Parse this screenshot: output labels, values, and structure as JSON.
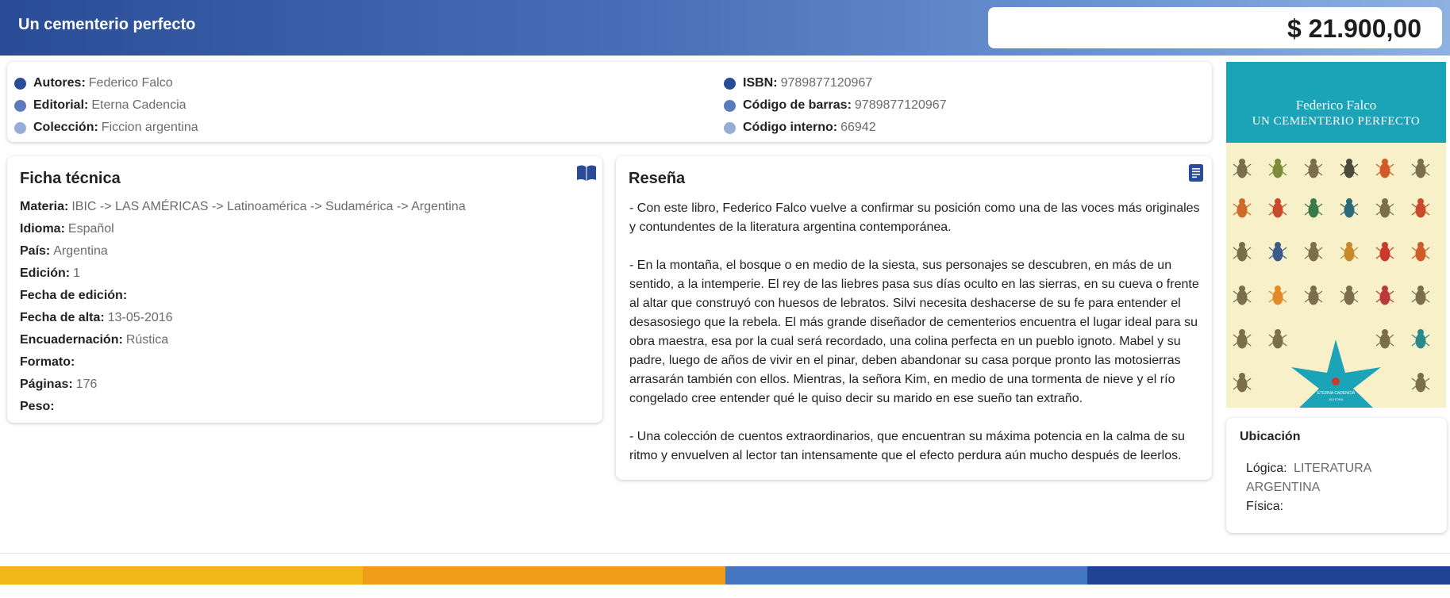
{
  "header": {
    "title": "Un cementerio perfecto",
    "price": "$ 21.900,00"
  },
  "info": {
    "left": [
      {
        "label": "Autores:",
        "value": "Federico Falco"
      },
      {
        "label": "Editorial:",
        "value": "Eterna Cadencia"
      },
      {
        "label": "Colección:",
        "value": "Ficcion argentina"
      }
    ],
    "right": [
      {
        "label": "ISBN:",
        "value": "9789877120967"
      },
      {
        "label": "Código de barras:",
        "value": "9789877120967"
      },
      {
        "label": "Código interno:",
        "value": "66942"
      }
    ]
  },
  "ficha": {
    "title": "Ficha técnica",
    "icon": "book-icon",
    "rows": [
      {
        "label": "Materia:",
        "value": "IBIC -> LAS AMÉRICAS -> Latinoamérica -> Sudamérica -> Argentina"
      },
      {
        "label": "Idioma:",
        "value": "Español"
      },
      {
        "label": "País:",
        "value": "Argentina"
      },
      {
        "label": "Edición:",
        "value": "1"
      },
      {
        "label": "Fecha de edición:",
        "value": ""
      },
      {
        "label": "Fecha de alta:",
        "value": "13-05-2016"
      },
      {
        "label": "Encuadernación:",
        "value": "Rústica"
      },
      {
        "label": "Formato:",
        "value": ""
      },
      {
        "label": "Páginas:",
        "value": "176"
      },
      {
        "label": "Peso:",
        "value": ""
      }
    ]
  },
  "resena": {
    "title": "Reseña",
    "icon": "document-icon",
    "paragraphs": [
      "- Con este libro, Federico Falco vuelve a confirmar su posición como una de las voces más originales y contundentes de la literatura argentina contemporánea.",
      "- En la montaña, el bosque o en medio de la siesta, sus personajes se descubren, en más de un sentido, a la intemperie. El rey de las liebres pasa sus días oculto en las sierras, en su cueva o frente al altar que construyó con huesos de lebratos. Silvi necesita deshacerse de su fe para entender el desasosiego que la rebela. El más grande diseñador de cementerios encuentra el lugar ideal para su obra maestra, esa por la cual será recordado, una colina perfecta en un pueblo ignoto. Mabel y su padre, luego de años de vivir en el pinar, deben abandonar su casa porque pronto las motosierras arrasarán también con ellos. Mientras, la señora Kim, en medio de una tormenta de nieve y el río congelado cree entender qué le quiso decir su marido en ese sueño tan extraño.",
      "- Una colección de cuentos extraordinarios, que encuentran su máxima potencia en la calma de su ritmo y envuelven al lector tan intensamente que el efecto perdura aún mucho después de leerlos."
    ]
  },
  "cover": {
    "author": "Federico Falco",
    "title": "UN CEMENTERIO PERFECTO",
    "publisher": "ETERNA CADENCIA",
    "publisher_sub": "EDITORA",
    "band_color": "#1ba3b7",
    "background_color": "#f7f0c9"
  },
  "ubicacion": {
    "title": "Ubicación",
    "logica_label": "Lógica:",
    "logica_value": "LITERATURA ARGENTINA",
    "fisica_label": "Física:",
    "fisica_value": ""
  },
  "footer": {
    "stripe_colors": [
      "#f2b718",
      "#f09e1a",
      "#4477c0",
      "#1f4494"
    ]
  }
}
